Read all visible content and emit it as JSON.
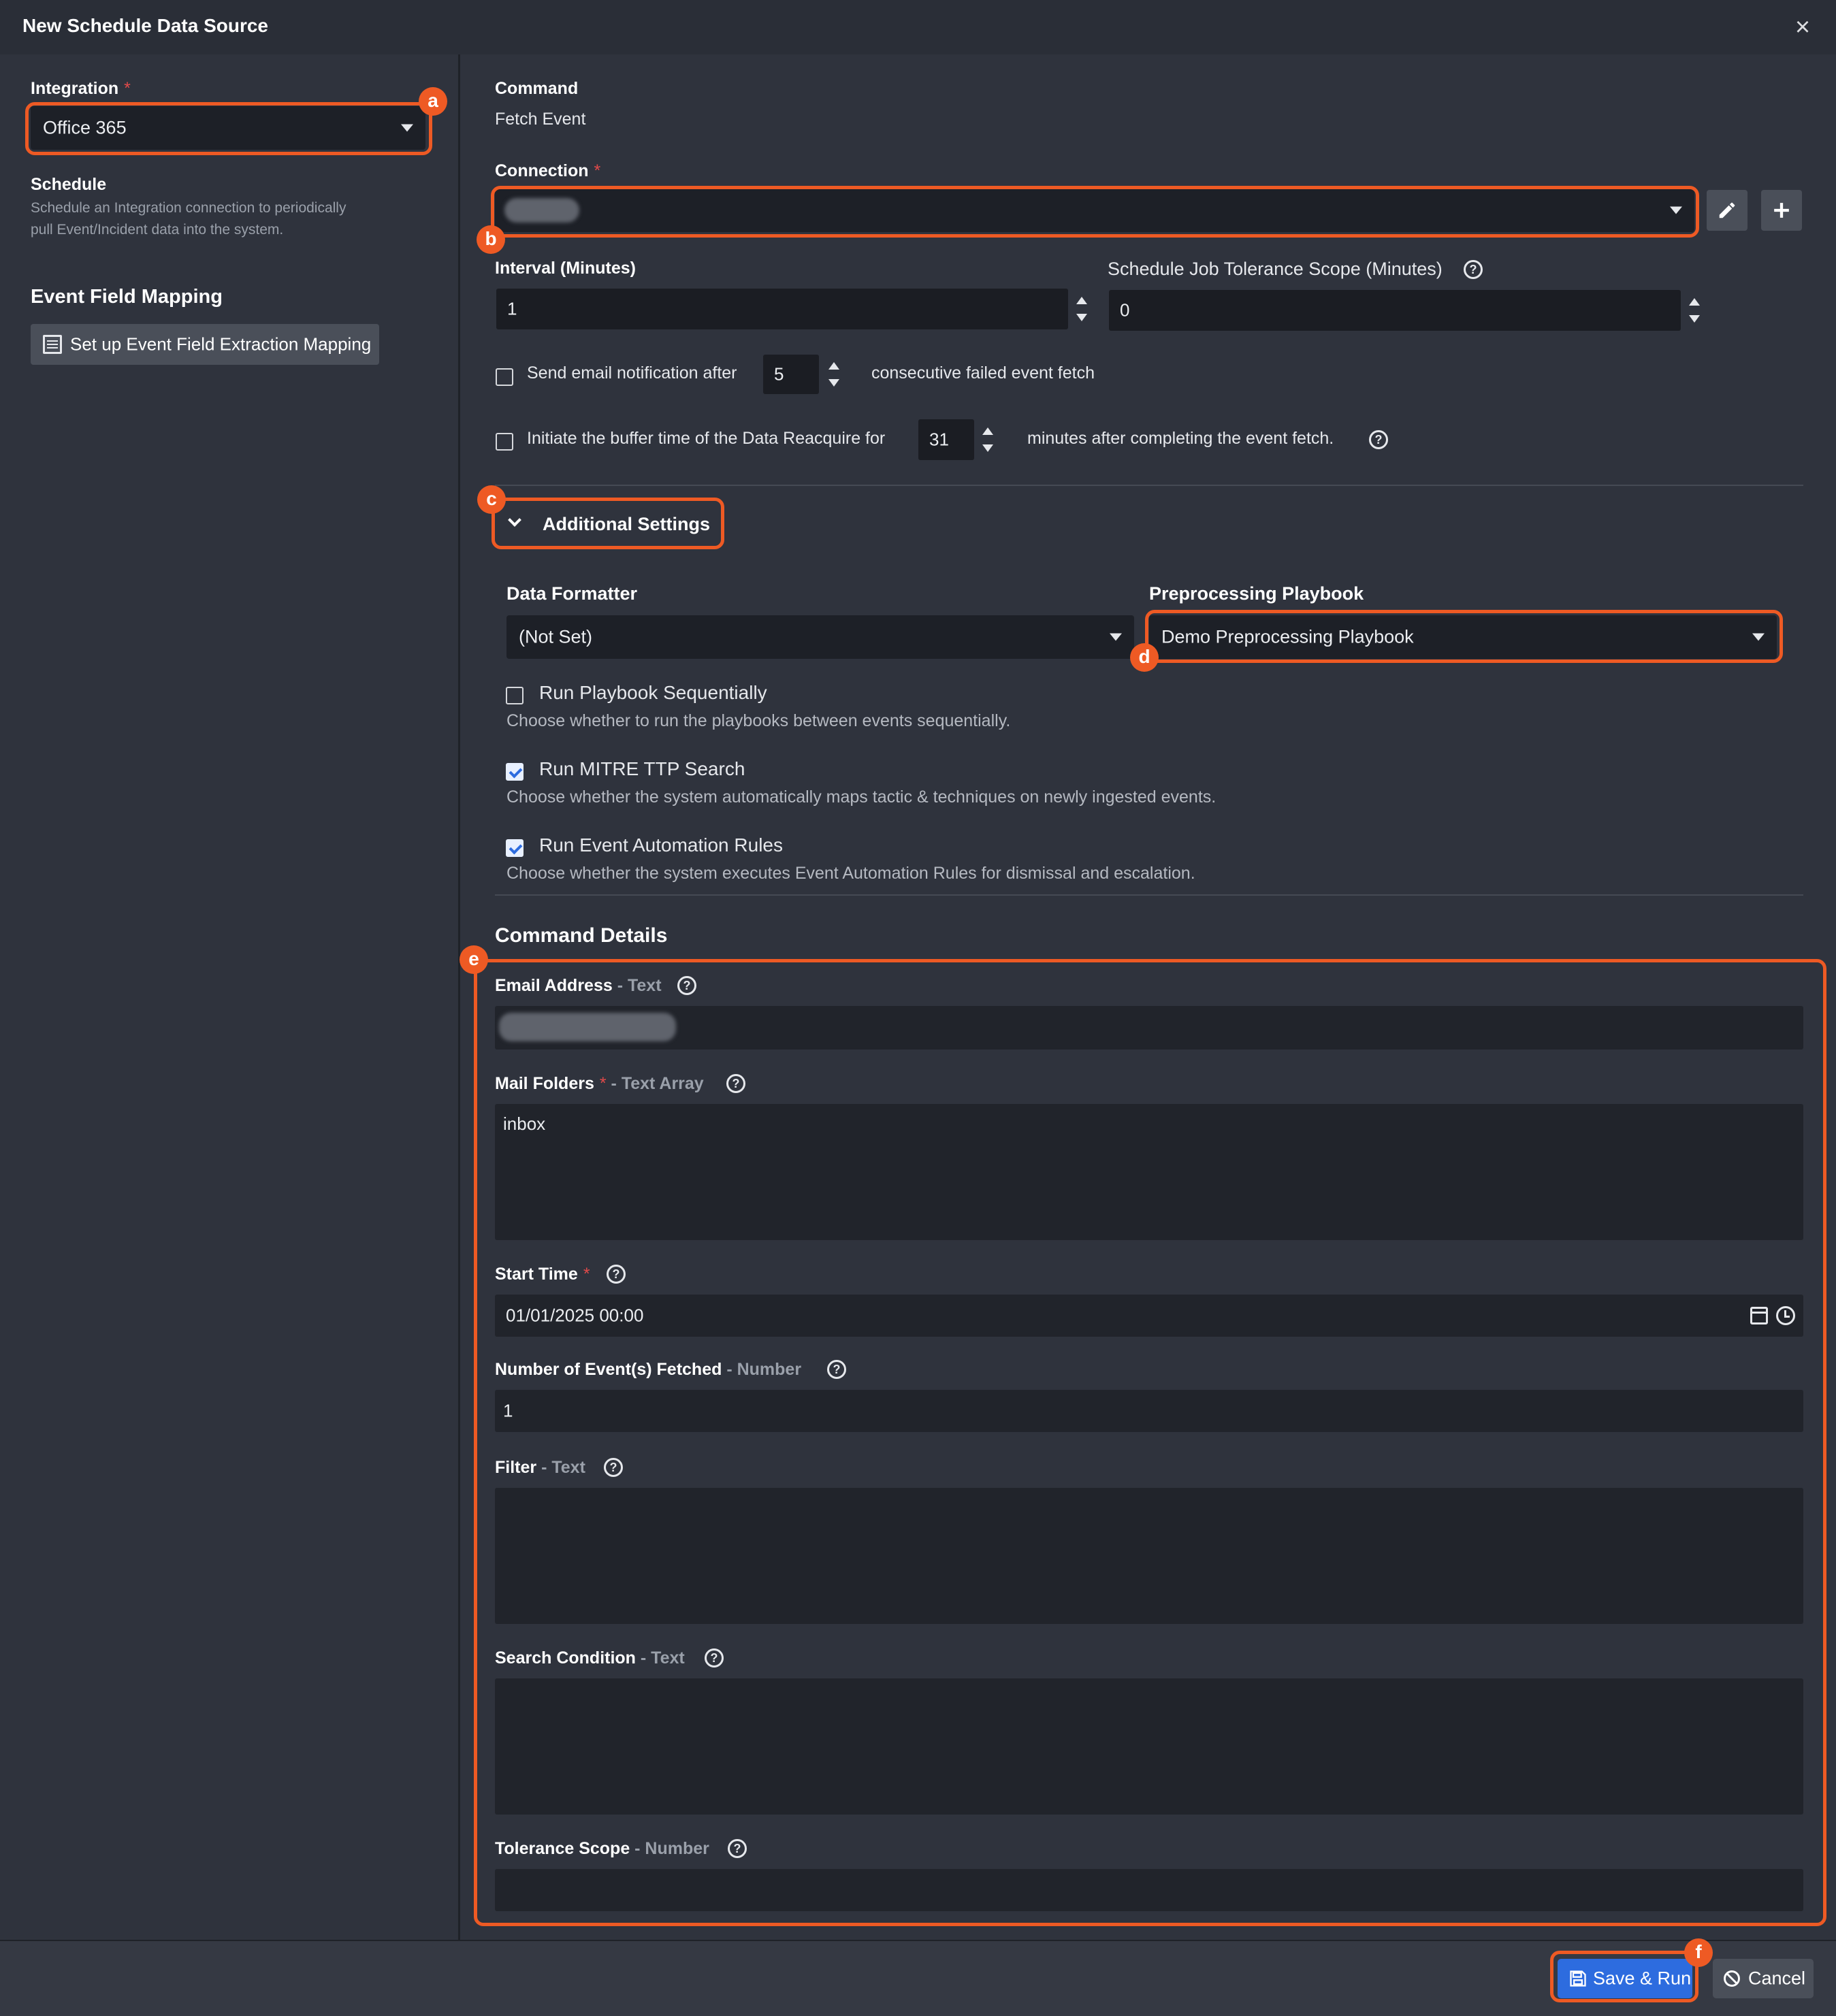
{
  "dialog": {
    "title": "New Schedule Data Source",
    "close": "×"
  },
  "left": {
    "integration_label": "Integration",
    "required_mark": "*",
    "integration_value": "Office 365",
    "schedule_title": "Schedule",
    "schedule_desc_1": "Schedule an Integration connection to periodically",
    "schedule_desc_2": "pull Event/Incident data into the system.",
    "mapping_title": "Event Field Mapping",
    "mapping_button": "Set up Event Field Extraction Mapping"
  },
  "command": {
    "label": "Command",
    "value": "Fetch Event"
  },
  "connection": {
    "label": "Connection",
    "required_mark": "*",
    "edit_icon": "pencil-icon",
    "add_icon": "plus-icon"
  },
  "interval": {
    "label": "Interval (Minutes)",
    "value": "1"
  },
  "tolerance": {
    "label": "Schedule Job Tolerance Scope (Minutes)",
    "value": "0"
  },
  "email_notify": {
    "checked": false,
    "prefix": "Send email notification after",
    "count": "5",
    "suffix": "consecutive failed event fetch"
  },
  "buffer": {
    "checked": false,
    "prefix": "Initiate the buffer time of the Data Reacquire for",
    "minutes": "31",
    "suffix": "minutes after completing the event fetch."
  },
  "additional": {
    "title": "Additional Settings",
    "formatter_label": "Data Formatter",
    "formatter_value": "(Not Set)",
    "playbook_label": "Preprocessing Playbook",
    "playbook_value": "Demo Preprocessing Playbook",
    "options": [
      {
        "label": "Run Playbook Sequentially",
        "desc": "Choose whether to run the playbooks between events sequentially.",
        "checked": false
      },
      {
        "label": "Run MITRE TTP Search",
        "desc": "Choose whether the system automatically maps tactic & techniques on newly ingested events.",
        "checked": true
      },
      {
        "label": "Run Event Automation Rules",
        "desc": "Choose whether the system executes Event Automation Rules for dismissal and escalation.",
        "checked": true
      }
    ]
  },
  "details": {
    "title": "Command Details",
    "fields": [
      {
        "label": "Email Address",
        "type": " - Text",
        "value": ""
      },
      {
        "label": "Mail Folders",
        "required": "*",
        "type": " - Text Array",
        "value": "inbox"
      },
      {
        "label": "Start Time",
        "required": "*",
        "value": "01/01/2025 00:00"
      },
      {
        "label": "Number of Event(s) Fetched",
        "type": " - Number",
        "value": "1"
      },
      {
        "label": "Filter",
        "type": " - Text",
        "value": ""
      },
      {
        "label": "Search Condition",
        "type": " - Text",
        "value": ""
      },
      {
        "label": "Tolerance Scope",
        "type": " - Number",
        "value": ""
      }
    ]
  },
  "callouts": {
    "a": "a",
    "b": "b",
    "c": "c",
    "d": "d",
    "e": "e",
    "f": "f"
  },
  "footer": {
    "save_run": "Save & Run",
    "cancel": "Cancel"
  },
  "colors": {
    "highlight": "#ee5a24",
    "primary": "#2d6cdf",
    "background": "#2f333d"
  }
}
